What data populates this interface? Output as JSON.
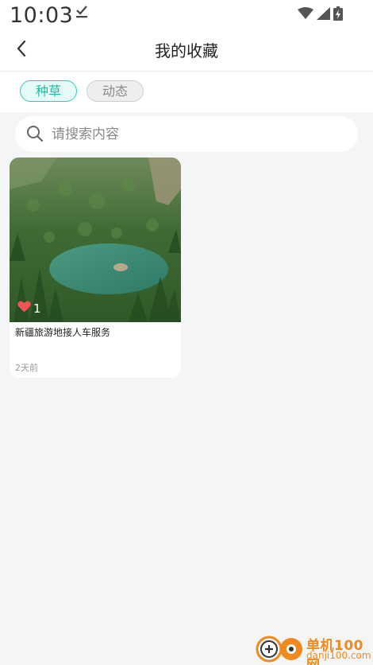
{
  "status_bar": {
    "time": "10:03",
    "icons": [
      "download-done-icon",
      "wifi-icon",
      "cell-signal-icon",
      "battery-charging-icon"
    ]
  },
  "header": {
    "title": "我的收藏",
    "back_icon": "chevron-left-icon"
  },
  "tabs": [
    {
      "label": "种草",
      "active": true
    },
    {
      "label": "动态",
      "active": false
    }
  ],
  "search": {
    "placeholder": "请搜索内容",
    "value": "",
    "icon": "search-icon"
  },
  "posts": [
    {
      "title": "新疆旅游地接人车服务",
      "likes": "1",
      "time": "2天前",
      "image": "forest-lake-photo"
    }
  ],
  "watermark": {
    "name": "单机100网",
    "url": "danji100.com"
  },
  "colors": {
    "accent": "#23b8a3",
    "background": "#f4f5f7",
    "like": "#f05454",
    "watermark": "#f08a1c"
  }
}
